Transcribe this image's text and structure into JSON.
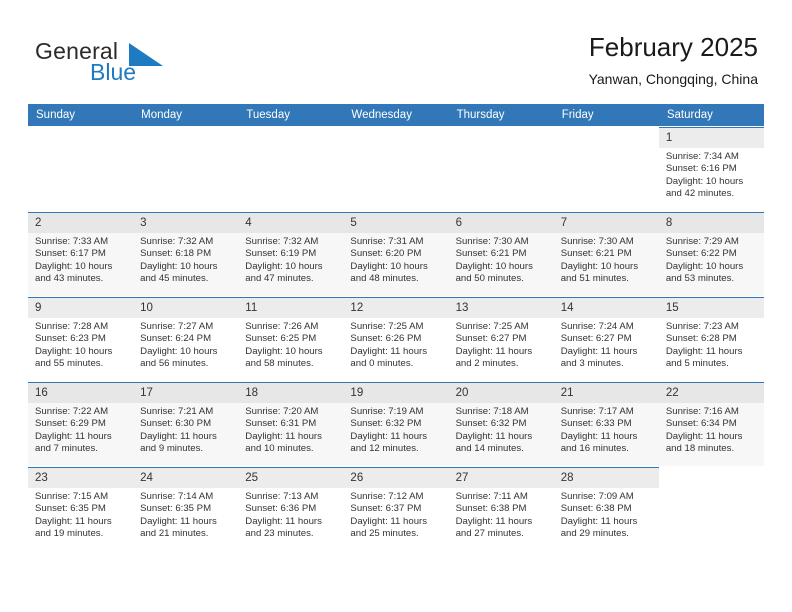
{
  "brand": {
    "word1": "General",
    "word2": "Blue",
    "logo_icon": "triangle-logo-icon",
    "blue": "#1f7bc1"
  },
  "header": {
    "title": "February 2025",
    "subtitle": "Yanwan, Chongqing, China"
  },
  "calendar": {
    "header_bg": "#3277b8",
    "weekdays": [
      "Sunday",
      "Monday",
      "Tuesday",
      "Wednesday",
      "Thursday",
      "Friday",
      "Saturday"
    ],
    "weeks": [
      [
        {
          "day": ""
        },
        {
          "day": ""
        },
        {
          "day": ""
        },
        {
          "day": ""
        },
        {
          "day": ""
        },
        {
          "day": ""
        },
        {
          "day": "1",
          "sunrise": "Sunrise: 7:34 AM",
          "sunset": "Sunset: 6:16 PM",
          "daylight": "Daylight: 10 hours and 42 minutes."
        }
      ],
      [
        {
          "day": "2",
          "sunrise": "Sunrise: 7:33 AM",
          "sunset": "Sunset: 6:17 PM",
          "daylight": "Daylight: 10 hours and 43 minutes."
        },
        {
          "day": "3",
          "sunrise": "Sunrise: 7:32 AM",
          "sunset": "Sunset: 6:18 PM",
          "daylight": "Daylight: 10 hours and 45 minutes."
        },
        {
          "day": "4",
          "sunrise": "Sunrise: 7:32 AM",
          "sunset": "Sunset: 6:19 PM",
          "daylight": "Daylight: 10 hours and 47 minutes."
        },
        {
          "day": "5",
          "sunrise": "Sunrise: 7:31 AM",
          "sunset": "Sunset: 6:20 PM",
          "daylight": "Daylight: 10 hours and 48 minutes."
        },
        {
          "day": "6",
          "sunrise": "Sunrise: 7:30 AM",
          "sunset": "Sunset: 6:21 PM",
          "daylight": "Daylight: 10 hours and 50 minutes."
        },
        {
          "day": "7",
          "sunrise": "Sunrise: 7:30 AM",
          "sunset": "Sunset: 6:21 PM",
          "daylight": "Daylight: 10 hours and 51 minutes."
        },
        {
          "day": "8",
          "sunrise": "Sunrise: 7:29 AM",
          "sunset": "Sunset: 6:22 PM",
          "daylight": "Daylight: 10 hours and 53 minutes."
        }
      ],
      [
        {
          "day": "9",
          "sunrise": "Sunrise: 7:28 AM",
          "sunset": "Sunset: 6:23 PM",
          "daylight": "Daylight: 10 hours and 55 minutes."
        },
        {
          "day": "10",
          "sunrise": "Sunrise: 7:27 AM",
          "sunset": "Sunset: 6:24 PM",
          "daylight": "Daylight: 10 hours and 56 minutes."
        },
        {
          "day": "11",
          "sunrise": "Sunrise: 7:26 AM",
          "sunset": "Sunset: 6:25 PM",
          "daylight": "Daylight: 10 hours and 58 minutes."
        },
        {
          "day": "12",
          "sunrise": "Sunrise: 7:25 AM",
          "sunset": "Sunset: 6:26 PM",
          "daylight": "Daylight: 11 hours and 0 minutes."
        },
        {
          "day": "13",
          "sunrise": "Sunrise: 7:25 AM",
          "sunset": "Sunset: 6:27 PM",
          "daylight": "Daylight: 11 hours and 2 minutes."
        },
        {
          "day": "14",
          "sunrise": "Sunrise: 7:24 AM",
          "sunset": "Sunset: 6:27 PM",
          "daylight": "Daylight: 11 hours and 3 minutes."
        },
        {
          "day": "15",
          "sunrise": "Sunrise: 7:23 AM",
          "sunset": "Sunset: 6:28 PM",
          "daylight": "Daylight: 11 hours and 5 minutes."
        }
      ],
      [
        {
          "day": "16",
          "sunrise": "Sunrise: 7:22 AM",
          "sunset": "Sunset: 6:29 PM",
          "daylight": "Daylight: 11 hours and 7 minutes."
        },
        {
          "day": "17",
          "sunrise": "Sunrise: 7:21 AM",
          "sunset": "Sunset: 6:30 PM",
          "daylight": "Daylight: 11 hours and 9 minutes."
        },
        {
          "day": "18",
          "sunrise": "Sunrise: 7:20 AM",
          "sunset": "Sunset: 6:31 PM",
          "daylight": "Daylight: 11 hours and 10 minutes."
        },
        {
          "day": "19",
          "sunrise": "Sunrise: 7:19 AM",
          "sunset": "Sunset: 6:32 PM",
          "daylight": "Daylight: 11 hours and 12 minutes."
        },
        {
          "day": "20",
          "sunrise": "Sunrise: 7:18 AM",
          "sunset": "Sunset: 6:32 PM",
          "daylight": "Daylight: 11 hours and 14 minutes."
        },
        {
          "day": "21",
          "sunrise": "Sunrise: 7:17 AM",
          "sunset": "Sunset: 6:33 PM",
          "daylight": "Daylight: 11 hours and 16 minutes."
        },
        {
          "day": "22",
          "sunrise": "Sunrise: 7:16 AM",
          "sunset": "Sunset: 6:34 PM",
          "daylight": "Daylight: 11 hours and 18 minutes."
        }
      ],
      [
        {
          "day": "23",
          "sunrise": "Sunrise: 7:15 AM",
          "sunset": "Sunset: 6:35 PM",
          "daylight": "Daylight: 11 hours and 19 minutes."
        },
        {
          "day": "24",
          "sunrise": "Sunrise: 7:14 AM",
          "sunset": "Sunset: 6:35 PM",
          "daylight": "Daylight: 11 hours and 21 minutes."
        },
        {
          "day": "25",
          "sunrise": "Sunrise: 7:13 AM",
          "sunset": "Sunset: 6:36 PM",
          "daylight": "Daylight: 11 hours and 23 minutes."
        },
        {
          "day": "26",
          "sunrise": "Sunrise: 7:12 AM",
          "sunset": "Sunset: 6:37 PM",
          "daylight": "Daylight: 11 hours and 25 minutes."
        },
        {
          "day": "27",
          "sunrise": "Sunrise: 7:11 AM",
          "sunset": "Sunset: 6:38 PM",
          "daylight": "Daylight: 11 hours and 27 minutes."
        },
        {
          "day": "28",
          "sunrise": "Sunrise: 7:09 AM",
          "sunset": "Sunset: 6:38 PM",
          "daylight": "Daylight: 11 hours and 29 minutes."
        },
        {
          "day": ""
        }
      ]
    ]
  }
}
